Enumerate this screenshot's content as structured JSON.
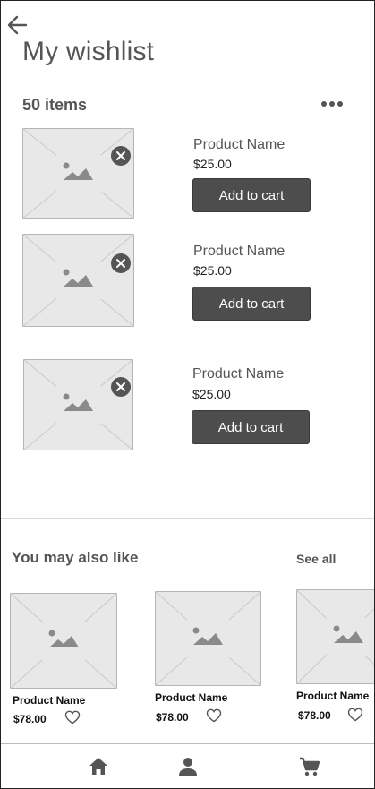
{
  "header": {
    "title": "My wishlist",
    "item_count": "50 items"
  },
  "wishlist": [
    {
      "name": "Product Name",
      "price": "$25.00",
      "button": "Add to cart"
    },
    {
      "name": "Product Name",
      "price": "$25.00",
      "button": "Add to cart"
    },
    {
      "name": "Product Name",
      "price": "$25.00",
      "button": "Add to cart"
    }
  ],
  "recommendations": {
    "title": "You may also like",
    "see_all": "See all",
    "items": [
      {
        "name": "Product Name",
        "price": "$78.00"
      },
      {
        "name": "Product Name",
        "price": "$78.00"
      },
      {
        "name": "Product Name",
        "price": "$78.00"
      }
    ]
  },
  "icons": {
    "back": "arrow-left-icon",
    "more": "more-horizontal-icon",
    "remove": "close-circle-icon",
    "image": "image-placeholder-icon",
    "heart": "heart-outline-icon",
    "home": "home-icon",
    "profile": "person-icon",
    "cart": "cart-icon"
  },
  "colors": {
    "button_bg": "#4d4d4d",
    "placeholder_bg": "#e8e8e8",
    "icon": "#555555"
  }
}
